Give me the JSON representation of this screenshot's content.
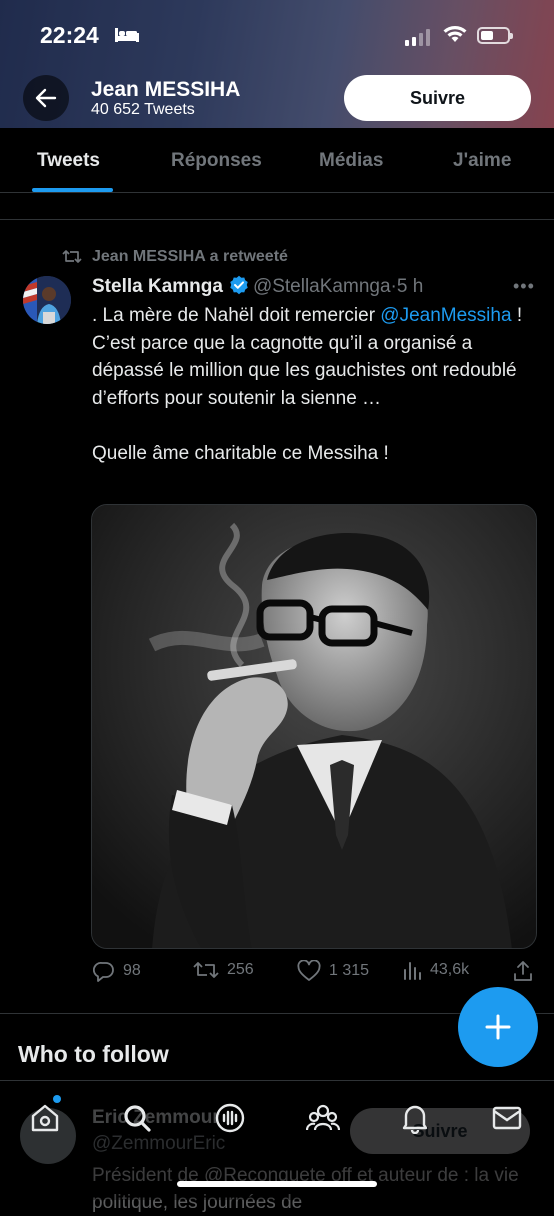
{
  "status_bar": {
    "time": "22:24"
  },
  "header": {
    "name": "Jean MESSIHA",
    "tweet_count": "40 652 Tweets",
    "follow_label": "Suivre"
  },
  "tabs": [
    {
      "label": "Tweets",
      "active": true
    },
    {
      "label": "Réponses",
      "active": false
    },
    {
      "label": "Médias",
      "active": false
    },
    {
      "label": "J'aime",
      "active": false
    }
  ],
  "tweet": {
    "retweet_context": "Jean MESSIHA a retweeté",
    "author_name": "Stella Kamnga",
    "author_handle": "@StellaKamnga",
    "separator": "·",
    "time": "5 h",
    "more": "•••",
    "text_before": ". La mère de Nahël doit remercier ",
    "mention": "@JeanMessiha",
    "text_after": " ! C’est parce que la cagnotte qu’il a organisé a dépassé le million que les gauchistes ont redoublé d’efforts pour soutenir la sienne …\n\nQuelle âme charitable ce Messiha !",
    "replies": "98",
    "retweets": "256",
    "likes": "1 315",
    "views": "43,6k"
  },
  "who_to_follow": {
    "title": "Who to follow",
    "suggestion": {
      "name": "Eric Zemmour",
      "handle": "@ZemmourEric",
      "bio": "Président de @Reconquete off et auteur de : la vie politique, les journées de",
      "follow_label": "Suivre"
    }
  },
  "colors": {
    "accent": "#1d9bf0",
    "background": "#000000",
    "secondary_text": "#71767b",
    "primary_text": "#e7e9ea"
  },
  "icons": {
    "bottom_nav": [
      "home-icon",
      "search-icon",
      "spaces-icon",
      "communities-icon",
      "notifications-icon",
      "messages-icon"
    ]
  }
}
